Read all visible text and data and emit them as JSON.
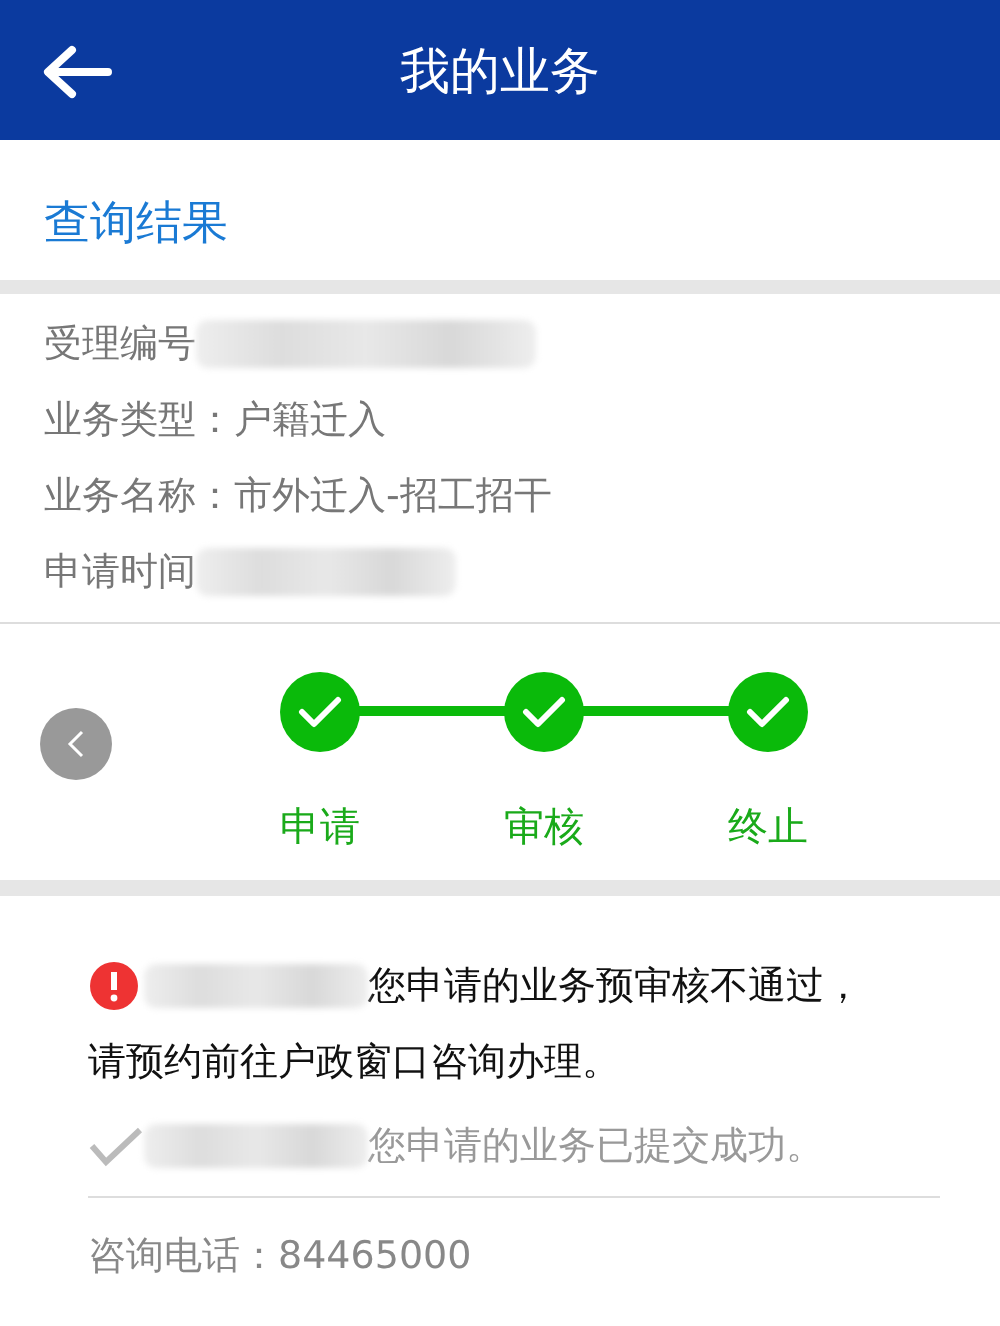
{
  "header": {
    "title": "我的业务"
  },
  "section_title": "查询结果",
  "fields": [
    {
      "label": "受理编号",
      "redacted": true
    },
    {
      "label": "业务类型：",
      "value": "户籍迁入"
    },
    {
      "label": "业务名称：",
      "value": "市外迁入-招工招干"
    },
    {
      "label": "申请时间",
      "redacted": true
    }
  ],
  "steps": [
    {
      "label": "申请",
      "done": true
    },
    {
      "label": "审核",
      "done": true
    },
    {
      "label": "终止",
      "done": true
    }
  ],
  "messages": [
    {
      "kind": "error",
      "lines": [
        "您申请的业务预审核不通过，",
        "请预约前往户政窗口咨询办理。"
      ]
    },
    {
      "kind": "success",
      "lines": [
        "您申请的业务已提交成功。"
      ]
    }
  ],
  "phone": "咨询电话：84465000"
}
